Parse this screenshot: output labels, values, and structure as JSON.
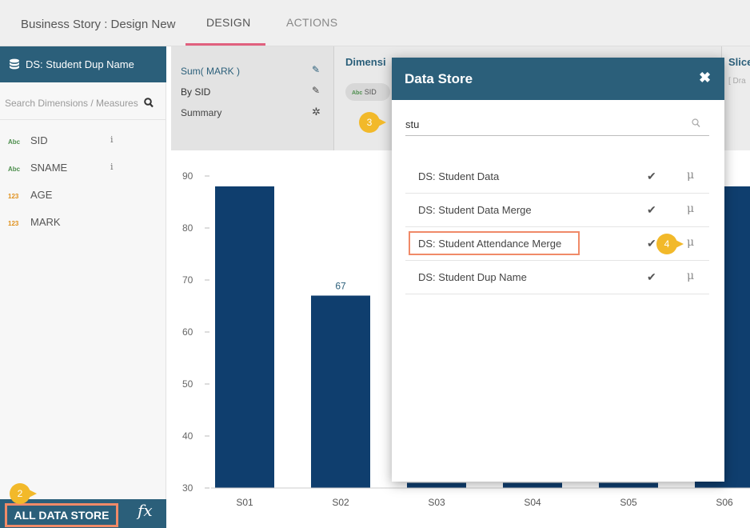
{
  "app": {
    "title": "Business Story : Design New",
    "tabs": [
      {
        "label": "DESIGN"
      },
      {
        "label": "ACTIONS"
      }
    ]
  },
  "sidebar": {
    "datastore_name": "DS: Student Dup Name",
    "search_placeholder": "Search Dimensions / Measures",
    "fields": [
      {
        "type": "Abc",
        "name": "SID",
        "info": "i"
      },
      {
        "type": "Abc",
        "name": "SNAME",
        "info": "i"
      },
      {
        "type": "123",
        "name": "AGE"
      },
      {
        "type": "123",
        "name": "MARK"
      }
    ],
    "footer_button": "ALL DATA STORE",
    "fx_label": "fx"
  },
  "config": {
    "measure": "Sum( MARK )",
    "by_label": "By SID",
    "summary_label": "Summary",
    "dimensions_title": "Dimensi",
    "dimension_chip": "SID",
    "dimension_chip_type": "Abc",
    "slice_title": "Slice",
    "slice_sub": "[ Dra"
  },
  "chart_data": {
    "type": "bar",
    "categories": [
      "S01",
      "S02",
      "S03",
      "S04",
      "S05",
      "S06"
    ],
    "values": [
      88,
      67,
      31,
      31,
      31,
      88
    ],
    "data_labels": [
      "",
      "67",
      "",
      "",
      "",
      ""
    ],
    "ylim": [
      30,
      90
    ],
    "yticks": [
      30,
      40,
      50,
      60,
      70,
      80,
      90
    ],
    "color": "#0f3e6e",
    "grid": false
  },
  "dialog": {
    "title": "Data Store",
    "close_icon": "times-icon",
    "search_value": "stu",
    "items": [
      {
        "label": "DS: Student Data",
        "check": "✔",
        "action": "μ"
      },
      {
        "label": "DS: Student Data Merge",
        "check": "✔",
        "action": "μ"
      },
      {
        "label": "DS: Student Attendance Merge",
        "check": "✔",
        "action": "μ"
      },
      {
        "label": "DS: Student Dup Name",
        "check": "✔",
        "action": "μ"
      }
    ]
  },
  "callouts": [
    {
      "number": "2"
    },
    {
      "number": "3"
    },
    {
      "number": "4"
    }
  ],
  "colors": {
    "header": "#2b5f7a",
    "bar": "#0f3e6e",
    "callout": "#f2b92a",
    "highlight": "#f08a68"
  }
}
